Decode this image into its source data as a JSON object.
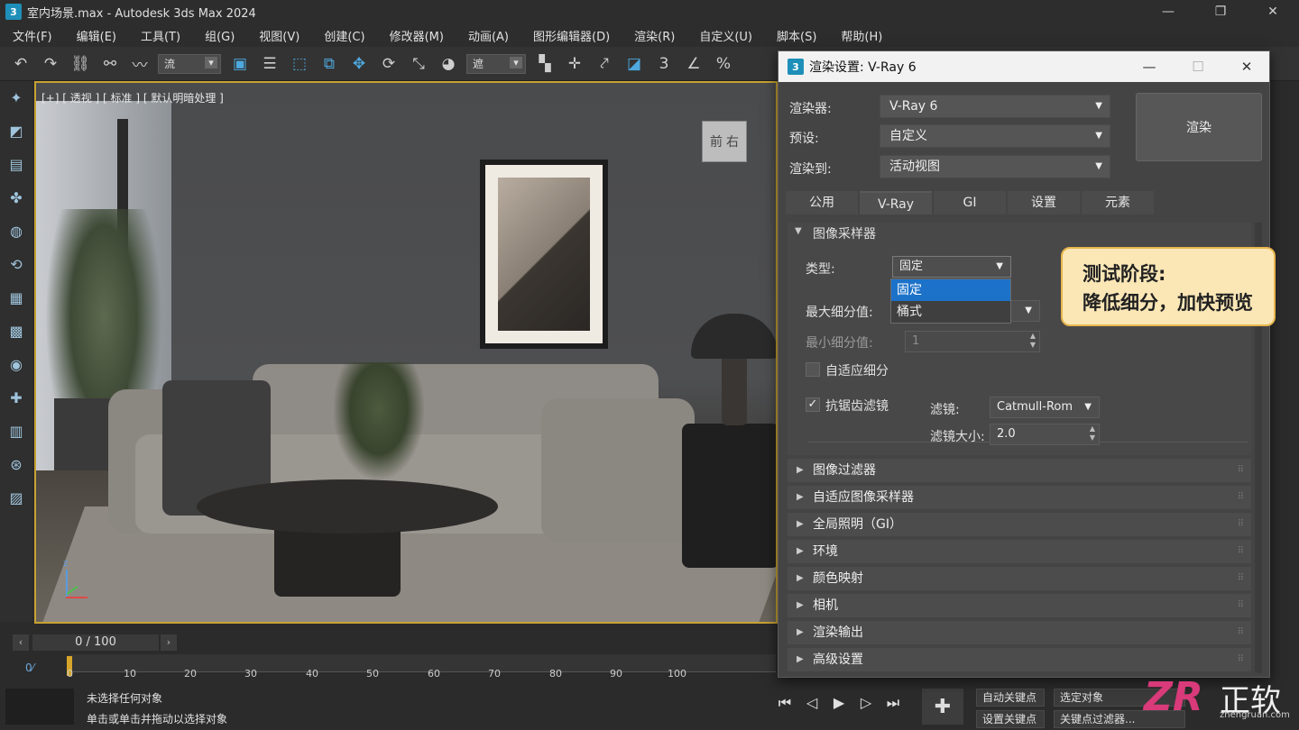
{
  "window": {
    "title": "室内场景.max - Autodesk 3ds Max 2024",
    "logo": "3"
  },
  "menu": [
    "文件(F)",
    "编辑(E)",
    "工具(T)",
    "组(G)",
    "视图(V)",
    "创建(C)",
    "修改器(M)",
    "动画(A)",
    "图形编辑器(D)",
    "渲染(R)",
    "自定义(U)",
    "脚本(S)",
    "帮助(H)"
  ],
  "toolbar": {
    "selection_filter": "流",
    "snap_filter": "遮"
  },
  "viewport": {
    "label": "[+] [ 透视 ] [ 标准 ] [ 默认明暗处理 ]",
    "cube_front": "前",
    "cube_right": "右",
    "axis_z": "z"
  },
  "timeline": {
    "frame": "0 / 100",
    "ticks": [
      "0",
      "10",
      "20",
      "30",
      "40",
      "50",
      "60",
      "70",
      "80",
      "90",
      "100"
    ]
  },
  "status": {
    "line1": "未选择任何对象",
    "line2": "单击或单击并拖动以选择对象"
  },
  "keys": {
    "auto_key": "自动关键点",
    "set_key": "设置关键点",
    "selected": "选定对象",
    "key_filters": "关键点过滤器..."
  },
  "dialog": {
    "title": "渲染设置: V-Ray 6",
    "renderer_label": "渲染器:",
    "renderer_value": "V-Ray 6",
    "preset_label": "预设:",
    "preset_value": "自定义",
    "render_to_label": "渲染到:",
    "render_to_value": "活动视图",
    "render_button": "渲染",
    "tabs": [
      "公用",
      "V-Ray",
      "GI",
      "设置",
      "元素"
    ],
    "active_tab": "V-Ray",
    "image_sampler": {
      "title": "图像采样器",
      "type_label": "类型:",
      "type_value": "固定",
      "type_options": [
        "固定",
        "桶式"
      ],
      "max_subdiv_label": "最大细分值:",
      "min_subdiv_label": "最小细分值:",
      "min_subdiv_value": "1",
      "adaptive_label": "自适应细分",
      "adaptive_checked": false,
      "aa_label": "抗锯齿滤镜",
      "aa_checked": true,
      "filter_label": "滤镜:",
      "filter_value": "Catmull-Rom",
      "filter_size_label": "滤镜大小:",
      "filter_size_value": "2.0"
    },
    "rollouts": [
      "图像过滤器",
      "自适应图像采样器",
      "全局照明（GI）",
      "环境",
      "颜色映射",
      "相机",
      "渲染输出",
      "高级设置"
    ]
  },
  "callout": {
    "line1": "测试阶段:",
    "line2": "降低细分，加快预览"
  },
  "watermark": {
    "mark": "ZR",
    "text": "正软",
    "sub": "zhengruan.com"
  }
}
